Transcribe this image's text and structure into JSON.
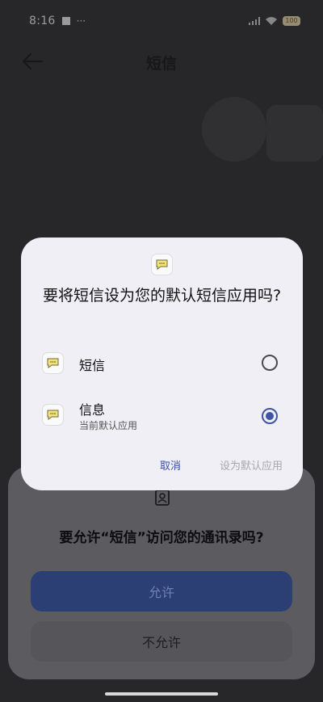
{
  "status_bar": {
    "time": "8:16",
    "extra": "···",
    "battery": "100"
  },
  "app_bar": {
    "title": "短信",
    "back_icon": "back-arrow-icon"
  },
  "permission_sheet": {
    "icon": "contacts-icon",
    "title": "要允许“短信”访问您的通讯录吗?",
    "allow_label": "允许",
    "deny_label": "不允许"
  },
  "dialog": {
    "title": "要将短信设为您的默认短信应用吗?",
    "options": [
      {
        "name": "短信",
        "sub": "",
        "selected": false
      },
      {
        "name": "信息",
        "sub": "当前默认应用",
        "selected": true
      }
    ],
    "cancel_label": "取消",
    "set_default_label": "设为默认应用"
  },
  "colors": {
    "accent": "#3c55a4",
    "dialog_bg": "#f0eff5",
    "disabled_text": "#a7a7ad"
  }
}
